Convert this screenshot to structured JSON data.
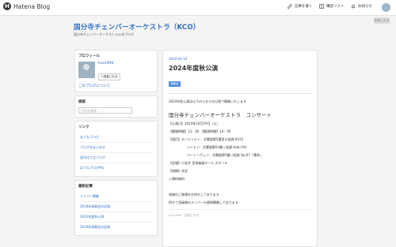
{
  "topbar": {
    "logo_mark": "H",
    "logo_text": "Hatena Blog",
    "write_label": "記事を書く",
    "reading_list_label": "購読リスト",
    "notice_label": "お知らせ"
  },
  "subscribe_label": "読者になる",
  "blog": {
    "title": "国分寺チェンバーオーケストラ（KCO）",
    "description": "国分寺チェンバーオーケストラ公式ブログ"
  },
  "sidebar": {
    "profile": {
      "heading": "プロフィール",
      "id": "kco1998",
      "reader_button": "＋読者になる",
      "about_link": "このブログについて"
    },
    "search": {
      "heading": "検索",
      "placeholder": "日記を検索"
    },
    "links": {
      "heading": "リンク",
      "items": [
        "はてなブログ",
        "ブログをはじめる",
        "週刊はてなブログ",
        "はてなブログPro"
      ]
    },
    "recent": {
      "heading": "最新記事",
      "items": [
        "メンバー募集",
        "2018年演奏会の記録",
        "2024年度秋公演",
        "2019年演奏会の記録"
      ]
    }
  },
  "post": {
    "date": "2024-04-14",
    "title": "2024年度秋公演",
    "category": "演奏会",
    "intro": "2024年秋公演は以下のとおりの日程で開催いたします",
    "concert_title": "国分寺チェンバーオーケストラ　コンサート",
    "date_line": "【公演日】2024年10月19日（土）",
    "time_line": "【開場時間】13：30　【開演時間】14：00",
    "program_line1": "【演目】モーツァルト：交響曲第5番変ロ長調 KV22",
    "program_line2": "ハイドン：交響曲第93番ニ長調 Hob.I:93",
    "program_line3": "ベートーヴェン：交響曲第5番ハ短調 Op.67「運命」",
    "venue_line": "【会場】小金井 宮地楽器ホール 大ホール",
    "conductor_line": "【指揮】未定",
    "admission_line": "入場料無料",
    "closing1": "皆様のご来場をお待ちしております",
    "closing2": "併せて団員様のメンバーも随時募集しております",
    "footer": "kco1998 · 読者になる"
  },
  "colors": {
    "accent": "#2f6fc2",
    "category_badge": "#4a90d9"
  }
}
